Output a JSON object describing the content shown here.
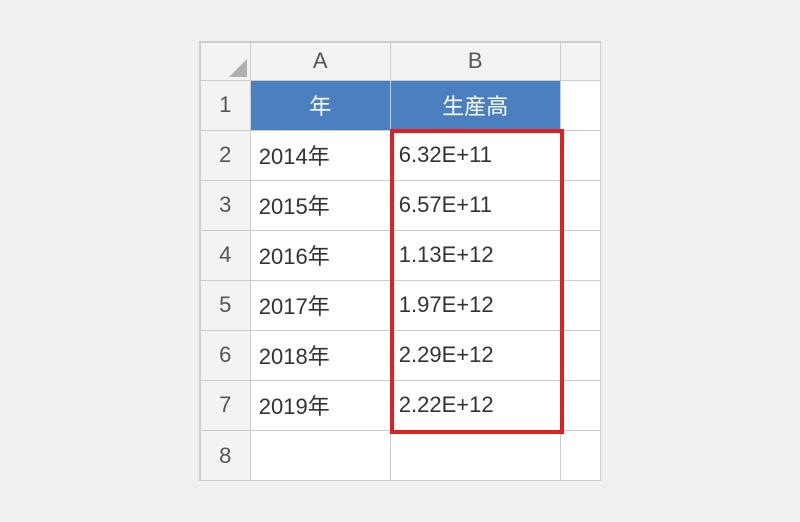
{
  "columns": {
    "a": "A",
    "b": "B"
  },
  "rowNumbers": [
    "1",
    "2",
    "3",
    "4",
    "5",
    "6",
    "7",
    "8"
  ],
  "headers": {
    "year": "年",
    "production": "生産高"
  },
  "rows": [
    {
      "year": "2014年",
      "value": "6.32E+11"
    },
    {
      "year": "2015年",
      "value": "6.57E+11"
    },
    {
      "year": "2016年",
      "value": "1.13E+12"
    },
    {
      "year": "2017年",
      "value": "1.97E+12"
    },
    {
      "year": "2018年",
      "value": "2.29E+12"
    },
    {
      "year": "2019年",
      "value": "2.22E+12"
    }
  ],
  "chart_data": {
    "type": "table",
    "title": "生産高",
    "columns": [
      "年",
      "生産高"
    ],
    "data": [
      {
        "年": "2014年",
        "生産高": 632000000000.0
      },
      {
        "年": "2015年",
        "生産高": 657000000000.0
      },
      {
        "年": "2016年",
        "生産高": 1130000000000.0
      },
      {
        "年": "2017年",
        "生産高": 1970000000000.0
      },
      {
        "年": "2018年",
        "生産高": 2290000000000.0
      },
      {
        "年": "2019年",
        "生産高": 2220000000000.0
      }
    ]
  }
}
